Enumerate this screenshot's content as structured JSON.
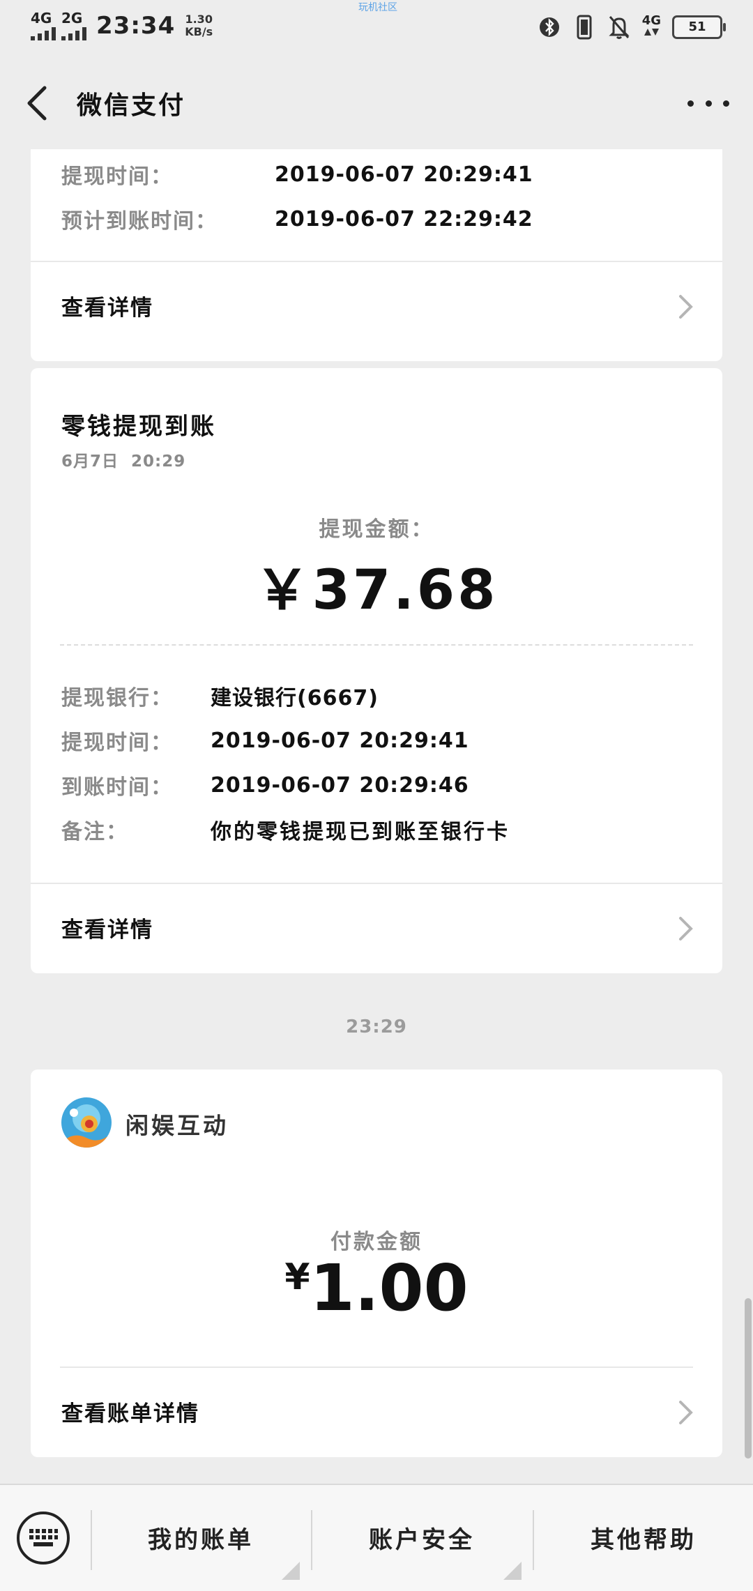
{
  "status_bar": {
    "net1": "4G",
    "net2": "2G",
    "time": "23:34",
    "speed_value": "1.30",
    "speed_unit": "KB/s",
    "watermark": "玩机社区",
    "net_right": "4G",
    "battery": "51"
  },
  "nav": {
    "title": "微信支付"
  },
  "card1_partial": {
    "rows": [
      {
        "label": "提现时间：",
        "value": "2019-06-07 20:29:41"
      },
      {
        "label": "预计到账时间：",
        "value": "2019-06-07 22:29:42"
      }
    ],
    "detail_label": "查看详情"
  },
  "card2": {
    "title": "零钱提现到账",
    "date": "6月7日  20:29",
    "amount_label": "提现金额：",
    "amount": "￥37.68",
    "rows": [
      {
        "label": "提现银行：",
        "value": "建设银行(6667)"
      },
      {
        "label": "提现时间：",
        "value": "2019-06-07 20:29:41"
      },
      {
        "label": "到账时间：",
        "value": "2019-06-07 20:29:46"
      },
      {
        "label": "备注：",
        "value": "你的零钱提现已到账至银行卡"
      }
    ],
    "detail_label": "查看详情"
  },
  "time_separator": "23:29",
  "card3": {
    "merchant": "闲娱互动",
    "amount_label": "付款金额",
    "currency": "¥",
    "amount": "1.00",
    "detail_label": "查看账单详情"
  },
  "bottom_bar": {
    "items": [
      "我的账单",
      "账户安全",
      "其他帮助"
    ]
  },
  "icons": [
    "back-arrow-icon",
    "more-icon",
    "chevron-right-icon",
    "keyboard-icon",
    "bluetooth-icon",
    "vibrate-icon",
    "mute-bell-icon",
    "battery-icon"
  ]
}
